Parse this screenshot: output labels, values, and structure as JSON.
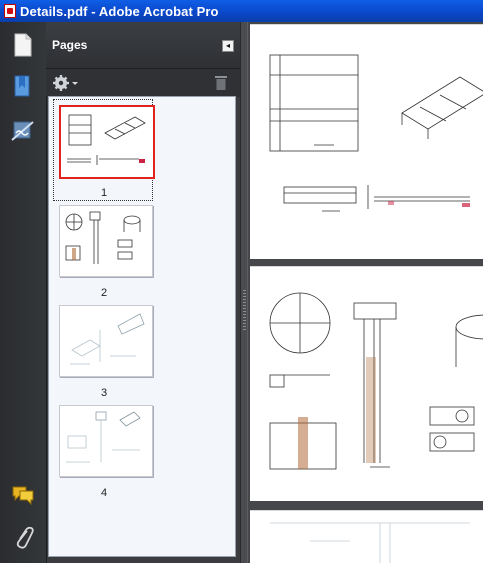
{
  "window": {
    "title": "Details.pdf - Adobe Acrobat Pro"
  },
  "rail": {
    "icons": [
      "page-thumbnails-icon",
      "bookmarks-icon",
      "signatures-icon",
      "comments-icon",
      "attachments-icon"
    ]
  },
  "pages_panel": {
    "title": "Pages",
    "collapse_glyph": "◂",
    "options_icon": "gear-icon",
    "delete_icon": "trash-icon",
    "thumbnails": [
      {
        "number": "1",
        "selected": true
      },
      {
        "number": "2",
        "selected": false
      },
      {
        "number": "3",
        "selected": false
      },
      {
        "number": "4",
        "selected": false
      }
    ]
  },
  "colors": {
    "titlebar": "#0a46c8",
    "panel_bg": "#2f3135",
    "thumb_area": "#f3f6fb",
    "selection": "#e0231e",
    "drawing_line": "#333333",
    "drawing_accent": "#b06a3a"
  }
}
